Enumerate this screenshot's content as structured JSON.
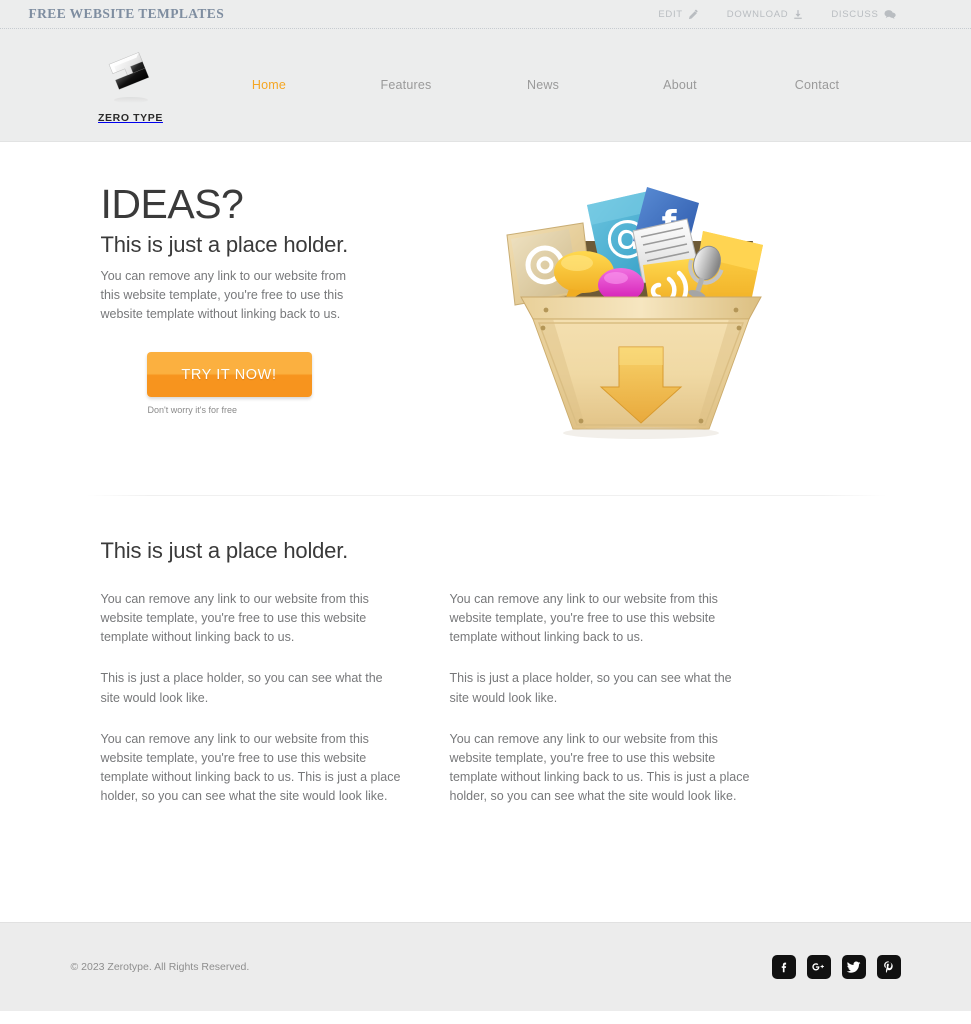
{
  "topbar": {
    "title": "FREE WEBSITE TEMPLATES",
    "links": [
      {
        "label": "EDIT",
        "icon": "pencil-icon"
      },
      {
        "label": "DOWNLOAD",
        "icon": "download-icon"
      },
      {
        "label": "DISCUSS",
        "icon": "comment-icon"
      }
    ]
  },
  "header": {
    "brand": {
      "name": "ZERO TYPE",
      "logo_icon": "zerotype-cube-logo"
    },
    "nav": [
      {
        "label": "Home",
        "active": true
      },
      {
        "label": "Features",
        "active": false
      },
      {
        "label": "News",
        "active": false
      },
      {
        "label": "About",
        "active": false
      },
      {
        "label": "Contact",
        "active": false
      }
    ],
    "accent_color": "#f5a623",
    "background_color": "#eceded"
  },
  "hero": {
    "heading": "IDEAS?",
    "subheading": "This is just a place holder.",
    "paragraph": "You can remove any link to our website from this website template, you're free to use this website template without linking back to us.",
    "cta_label": "TRY IT NOW!",
    "cta_note": "Don't worry it's for free",
    "cta_color": "#f7941e",
    "illustration": "download-crate-with-social-media-icons"
  },
  "content": {
    "heading": "This is just a place holder.",
    "columns": [
      {
        "paragraphs": [
          "You can remove any link to our website from this website template, you're free to use this website template without linking back to us.",
          "This is just a place holder, so you can see what the site would look like.",
          "You can remove any link to our website from this website template, you're free to use this website template without linking back to us. This is just a place holder, so you can see what the site would look like."
        ]
      },
      {
        "paragraphs": [
          "You can remove any link to our website from this website template, you're free to use this website template without linking back to us.",
          "This is just a place holder, so you can see what the site would look like.",
          "You can remove any link to our website from this website template, you're free to use this website template without linking back to us. This is just a place holder, so you can see what the site would look like."
        ]
      }
    ]
  },
  "footer": {
    "copyright": "© 2023 Zerotype. All Rights Reserved.",
    "socials": [
      {
        "name": "facebook",
        "icon": "facebook-icon"
      },
      {
        "name": "google-plus",
        "icon": "google-plus-icon"
      },
      {
        "name": "twitter",
        "icon": "twitter-icon"
      },
      {
        "name": "pinterest",
        "icon": "pinterest-icon"
      }
    ],
    "background_color": "#ececec"
  }
}
